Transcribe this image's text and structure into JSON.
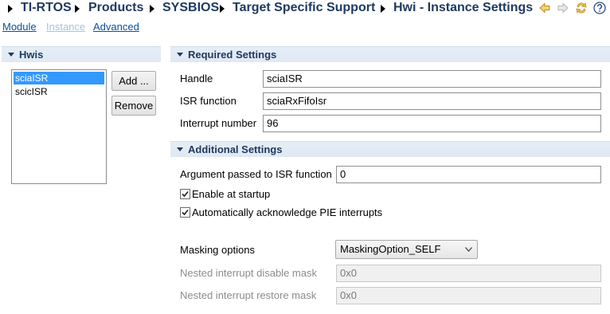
{
  "breadcrumb": {
    "items": [
      "TI-RTOS",
      "Products",
      "SYSBIOS",
      "Target Specific Support",
      "Hwi - Instance Settings"
    ],
    "icons": [
      "back-arrow-icon",
      "forward-arrow-icon",
      "refresh-icon",
      "help-icon"
    ]
  },
  "modes": {
    "module": "Module",
    "instance": "Instance",
    "advanced": "Advanced"
  },
  "hwis": {
    "title": "Hwis",
    "items": [
      "sciaISR",
      "scicISR"
    ],
    "selected": "sciaISR",
    "add_label": "Add ...",
    "remove_label": "Remove"
  },
  "required": {
    "title": "Required Settings",
    "handle_label": "Handle",
    "handle_value": "sciaISR",
    "isr_label": "ISR function",
    "isr_value": "sciaRxFifoIsr",
    "intnum_label": "Interrupt number",
    "intnum_value": "96"
  },
  "additional": {
    "title": "Additional Settings",
    "arg_label": "Argument passed to ISR function",
    "arg_value": "0",
    "enable_label": "Enable at startup",
    "enable_checked": true,
    "ack_label": "Automatically acknowledge PIE interrupts",
    "ack_checked": true,
    "masking_label": "Masking options",
    "masking_value": "MaskingOption_SELF",
    "disable_mask_label": "Nested interrupt disable mask",
    "disable_mask_value": "0x0",
    "restore_mask_label": "Nested interrupt restore mask",
    "restore_mask_value": "0x0"
  },
  "colors": {
    "header_text": "#1f3a60",
    "link": "#0b4fa0",
    "link_disabled": "#a6c3e0",
    "selection": "#3399ff",
    "section_bg": "#e2eaf4"
  }
}
